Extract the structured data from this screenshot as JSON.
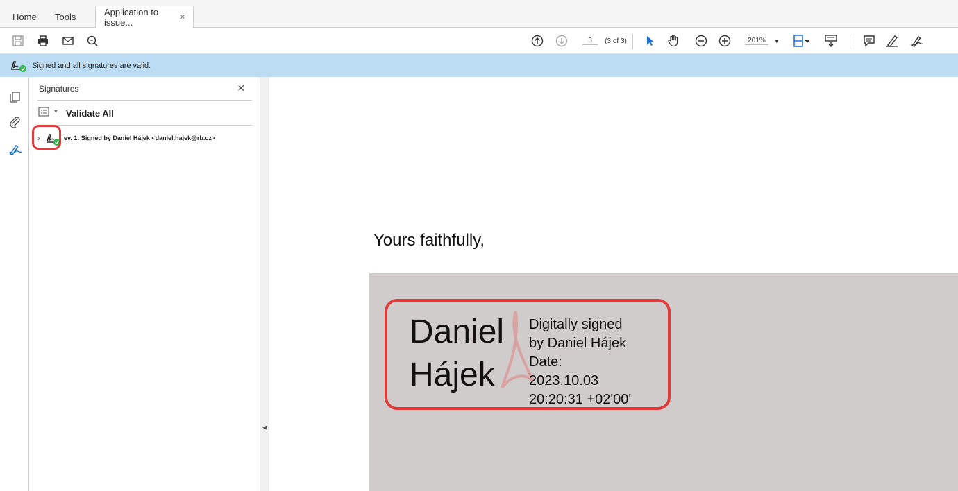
{
  "tabs": {
    "home": "Home",
    "tools": "Tools",
    "document": "Application to issue...",
    "close": "×"
  },
  "toolbar": {
    "page_current": "3",
    "page_total": "(3 of 3)",
    "zoom": "201%"
  },
  "signature_bar": {
    "message": "Signed and all signatures are valid."
  },
  "panel": {
    "title": "Signatures",
    "close": "×",
    "validate_all": "Validate All",
    "revision": "ev. 1: Signed by Daniel Hájek <daniel.hajek@rb.cz>"
  },
  "document": {
    "closing": "Yours faithfully,",
    "signature_name_line1": "Daniel",
    "signature_name_line2": "Hájek",
    "signature_details": [
      "Digitally signed",
      "by Daniel Hájek",
      "Date:",
      "2023.10.03",
      "20:20:31 +02'00'"
    ]
  },
  "colors": {
    "accent": "#1a6fd0",
    "highlight": "#e23b3b",
    "valid": "#2fb34a",
    "sigbar_bg": "#bcdcf3"
  }
}
